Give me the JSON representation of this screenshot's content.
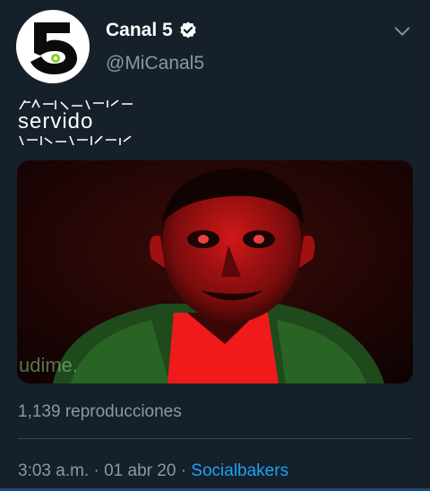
{
  "account": {
    "display_name": "Canal 5",
    "handle": "@MiCanal5",
    "verified": true,
    "avatar_icon": "canal5-logo",
    "verified_icon": "verified-check-icon"
  },
  "tweet": {
    "text": "servido"
  },
  "media": {
    "type": "video",
    "watermark": "udime."
  },
  "stats": {
    "views": "1,139 reproducciones"
  },
  "meta": {
    "time": "3:03 a.m.",
    "separator": "·",
    "date": "01 abr 20",
    "source": "Socialbakers"
  },
  "colors": {
    "background": "#15202b",
    "text_primary": "#ffffff",
    "text_secondary": "#8899a6",
    "link": "#1da1f2",
    "divider": "#38444d"
  }
}
